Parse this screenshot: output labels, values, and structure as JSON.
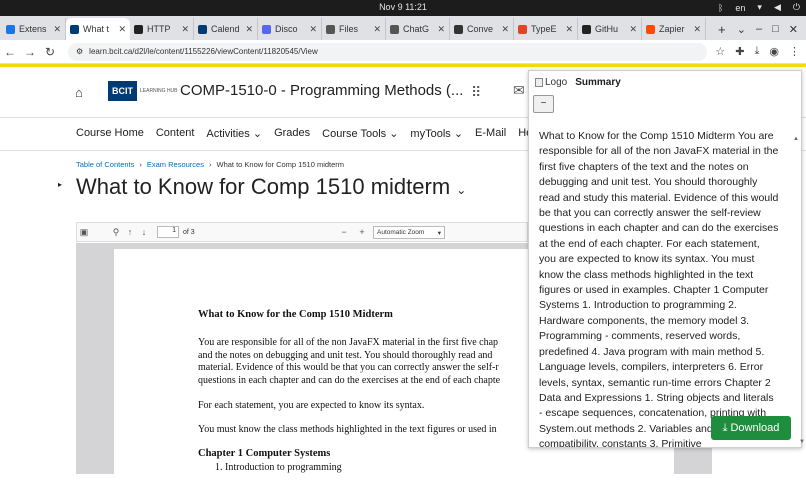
{
  "os": {
    "clock": "Nov 9  11:21",
    "lang": "en"
  },
  "tabs": [
    {
      "title": "Extens",
      "color": "#1a73e8",
      "active": false
    },
    {
      "title": "What t",
      "color": "#003c71",
      "active": true
    },
    {
      "title": "HTTP",
      "color": "#222222",
      "active": false
    },
    {
      "title": "Calend",
      "color": "#003c71",
      "active": false
    },
    {
      "title": "Disco",
      "color": "#5865f2",
      "active": false
    },
    {
      "title": "Files",
      "color": "#555555",
      "active": false
    },
    {
      "title": "ChatG",
      "color": "#555555",
      "active": false
    },
    {
      "title": "Conve",
      "color": "#333333",
      "active": false
    },
    {
      "title": "TypeE",
      "color": "#e24329",
      "active": false
    },
    {
      "title": "GitHu",
      "color": "#222222",
      "active": false
    },
    {
      "title": "Zapier",
      "color": "#ff4a00",
      "active": false
    }
  ],
  "address": {
    "url": "learn.bcit.ca/d2l/le/content/1155226/viewContent/11820545/View"
  },
  "header": {
    "logo_text": "BCIT",
    "logo_sub": "LEARNING HUB",
    "course_title": "COMP-1510-0 - Programming Methods (..."
  },
  "nav": {
    "items": [
      "Course Home",
      "Content",
      "Activities ⌄",
      "Grades",
      "Course Tools ⌄",
      "myTools ⌄",
      "E-Mail",
      "Help!"
    ]
  },
  "breadcrumb": {
    "toc": "Table of Contents",
    "sep": "›",
    "resources": "Exam Resources",
    "current": "What to Know for Comp 1510 midterm"
  },
  "heading": "What to Know for Comp 1510 midterm",
  "pdf": {
    "page": "1",
    "of": "of 3",
    "zoom": "Automatic Zoom",
    "title": "What to Know for the Comp 1510 Midterm",
    "lines": [
      "You are responsible for all of the non JavaFX material in the first five chap",
      "and the notes on debugging and unit test.  You should thoroughly read and",
      "material.  Evidence of this would be that you can correctly answer the self-r",
      "questions in each chapter and can do the exercises at the end of each chapte",
      "For each statement, you are expected to know its syntax.",
      "You must know the class methods highlighted in the text figures or used in"
    ],
    "chapter": "Chapter 1 Computer Systems",
    "item1": "1.  Introduction to programming"
  },
  "summary": {
    "logo_alt": "Logo",
    "title": "Summary",
    "collapse": "−",
    "body": "What to Know for the Comp 1510 Midterm You are responsible for all of the non JavaFX material in the first five chapters of the text and the notes on debugging and unit test. You should thoroughly read and study this material. Evidence of this would be that you can correctly answer the self-review questions in each chapter and can do the exercises at the end of each chapter. For each statement, you are expected to know its syntax. You must know the class methods highlighted in the text figures or used in examples. Chapter 1 Computer Systems 1. Introduction to programming 2. Hardware components, the memory model 3. Programming - comments, reserved words, predefined 4. Java program with main method 5. Language levels, compilers, interpreters 6. Error levels, syntax, semantic run-time errors Chapter 2 Data and Expressions 1. String objects and literals - escape sequences, concatenation, printing with System.out methods 2. Variables and declaration, compatibility, constants 3. Primitive"
  },
  "download": {
    "label": "Download"
  }
}
